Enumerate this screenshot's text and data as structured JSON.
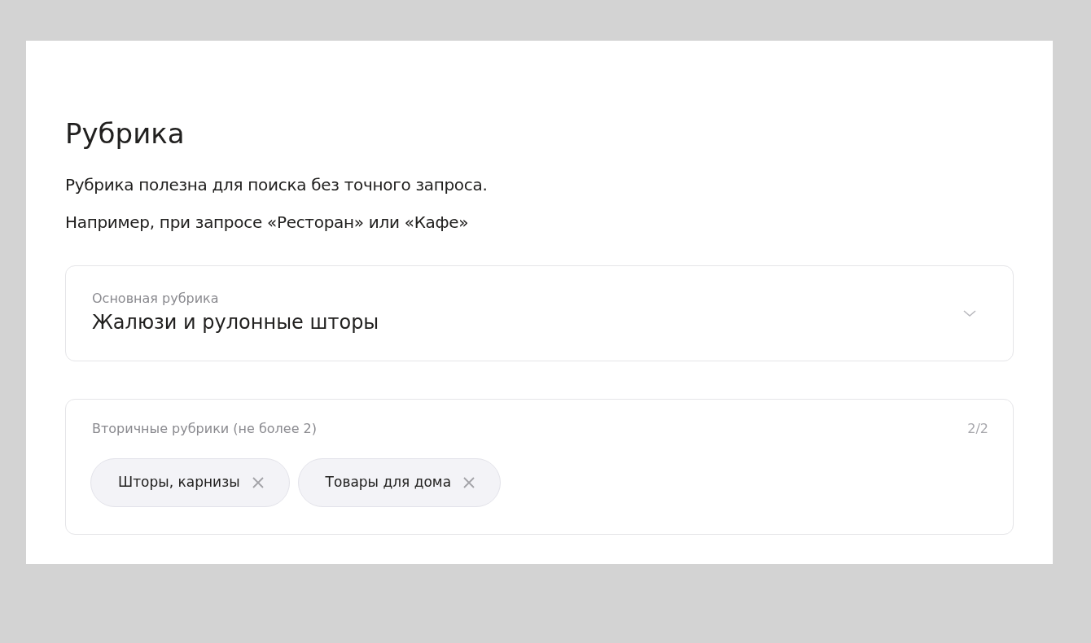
{
  "title": "Рубрика",
  "description": [
    "Рубрика полезна для поиска без точного запроса.",
    "Например, при запросе «Ресторан» или «Кафе»"
  ],
  "main_category": {
    "label": "Основная рубрика",
    "value": "Жалюзи и рулонные шторы"
  },
  "secondary_categories": {
    "label": "Вторичные рубрики (не более 2)",
    "counter": "2/2",
    "tags": [
      {
        "label": "Шторы, карнизы"
      },
      {
        "label": "Товары для дома"
      }
    ]
  }
}
